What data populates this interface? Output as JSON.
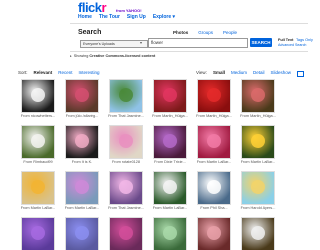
{
  "header": {
    "logo_part1": "flick",
    "logo_part2": "r",
    "logo_tagline": "from YAHOO!",
    "nav": [
      "Home",
      "The Tour",
      "Sign Up",
      "Explore ▾"
    ]
  },
  "search": {
    "title": "Search",
    "tabs": [
      "Photos",
      "Groups",
      "People"
    ],
    "active_tab": "Photos",
    "scope": "Everyone's Uploads",
    "query": "flower",
    "button": "SEARCH",
    "fulltext": "Full Text",
    "tagsonly": "Tags Only",
    "advanced": "Advanced Search",
    "notice_prefix": "Showing",
    "notice_bold": "Creative Commons-licensed content"
  },
  "sort": {
    "label": "Sort:",
    "options": [
      "Relevant",
      "Recent",
      "Interesting"
    ],
    "active": "Relevant"
  },
  "view": {
    "label": "View:",
    "options": [
      "Small",
      "Medium",
      "Detail",
      "Slideshow"
    ],
    "active": "Small"
  },
  "photos": [
    {
      "credit": "From nicowhetters...",
      "colors": [
        "#1a1a1a",
        "#f4f4f4"
      ]
    },
    {
      "credit": "From jûlo /allarèg...",
      "colors": [
        "#5a3a2a",
        "#d44f70"
      ]
    },
    {
      "credit": "From That Jasmine...",
      "colors": [
        "#8fc2e6",
        "#4a8a3a"
      ]
    },
    {
      "credit": "From Martin_Hüiga...",
      "colors": [
        "#7e1a1a",
        "#e0355f"
      ]
    },
    {
      "credit": "From Martin_Hüiga...",
      "colors": [
        "#8a0e0e",
        "#e42a2a"
      ]
    },
    {
      "credit": "From Martin_Hüiga...",
      "colors": [
        "#4a3a1a",
        "#d96a6a"
      ]
    },
    {
      "credit": "From Rimbaud99",
      "colors": [
        "#4a6a2a",
        "#f3f3f0"
      ]
    },
    {
      "credit": "From It is K.",
      "colors": [
        "#1a1a1a",
        "#f0aac4"
      ]
    },
    {
      "credit": "From rotate0128",
      "colors": [
        "#e0d7c6",
        "#e98fc0"
      ]
    },
    {
      "credit": "From Dixie Trixie...",
      "colors": [
        "#4a1a3a",
        "#b468c8"
      ]
    },
    {
      "credit": "From Martin LaBar...",
      "colors": [
        "#a01a40",
        "#f27aa6"
      ]
    },
    {
      "credit": "From Martin LaBar...",
      "colors": [
        "#2a4a1a",
        "#ffd035"
      ]
    },
    {
      "credit": "From Martin LaBar...",
      "colors": [
        "#d9c28a",
        "#f2b433"
      ]
    },
    {
      "credit": "From Martin LaBar...",
      "colors": [
        "#7a9aba",
        "#ce8ad8"
      ]
    },
    {
      "credit": "From That Jasmine...",
      "colors": [
        "#6a4a8a",
        "#f1b6e6"
      ]
    },
    {
      "credit": "From Martin LaBar...",
      "colors": [
        "#2a5a2a",
        "#f3f3f3"
      ]
    },
    {
      "credit": "From Phil Sha...",
      "colors": [
        "#4a6a8a",
        "#ffffff"
      ]
    },
    {
      "credit": "From Harold Ayers...",
      "colors": [
        "#8ad0e8",
        "#f2d36a"
      ]
    },
    {
      "credit": "",
      "colors": [
        "#5a3a9a",
        "#a66ae0"
      ]
    },
    {
      "credit": "",
      "colors": [
        "#5a5aa0",
        "#8b8ef0"
      ]
    },
    {
      "credit": "",
      "colors": [
        "#6a2a5a",
        "#d24e9a"
      ]
    },
    {
      "credit": "",
      "colors": [
        "#3a6a3a",
        "#a8d8a8"
      ]
    },
    {
      "credit": "",
      "colors": [
        "#6a2a2a",
        "#e8a0a8"
      ]
    },
    {
      "credit": "",
      "colors": [
        "#4a3a1a",
        "#f0f0f0"
      ]
    }
  ]
}
